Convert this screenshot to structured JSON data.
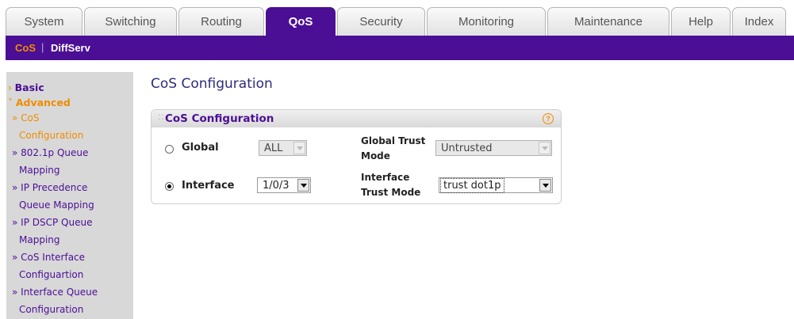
{
  "top_tabs": [
    {
      "label": "System"
    },
    {
      "label": "Switching"
    },
    {
      "label": "Routing"
    },
    {
      "label": "QoS"
    },
    {
      "label": "Security"
    },
    {
      "label": "Monitoring"
    },
    {
      "label": "Maintenance"
    },
    {
      "label": "Help"
    },
    {
      "label": "Index"
    }
  ],
  "sub_nav": {
    "items": [
      {
        "label": "CoS"
      },
      {
        "label": "DiffServ"
      }
    ],
    "separator": "|"
  },
  "sidebar": {
    "basic": "Basic",
    "advanced": "Advanced",
    "items": [
      {
        "lines": [
          "» CoS",
          "Configuration"
        ]
      },
      {
        "lines": [
          "» 802.1p Queue",
          "Mapping"
        ]
      },
      {
        "lines": [
          "» IP Precedence",
          "Queue Mapping"
        ]
      },
      {
        "lines": [
          "» IP DSCP Queue",
          "Mapping"
        ]
      },
      {
        "lines": [
          "» CoS Interface",
          "Configuartion"
        ]
      },
      {
        "lines": [
          "» Interface Queue",
          "Configuration"
        ]
      }
    ]
  },
  "page_title": "CoS Configuration",
  "panel": {
    "title": "CoS Configuration",
    "help_icon": "?",
    "global": {
      "label": "Global",
      "value": "ALL",
      "trust_label_1": "Global Trust",
      "trust_label_2": "Mode",
      "trust_value": "Untrusted"
    },
    "interface": {
      "label": "Interface",
      "value": "1/0/3",
      "trust_label_1": "Interface",
      "trust_label_2": "Trust Mode",
      "trust_value": "trust dot1p"
    }
  },
  "colors": {
    "brand_purple": "#4b0f95",
    "accent_orange": "#f08c00"
  }
}
